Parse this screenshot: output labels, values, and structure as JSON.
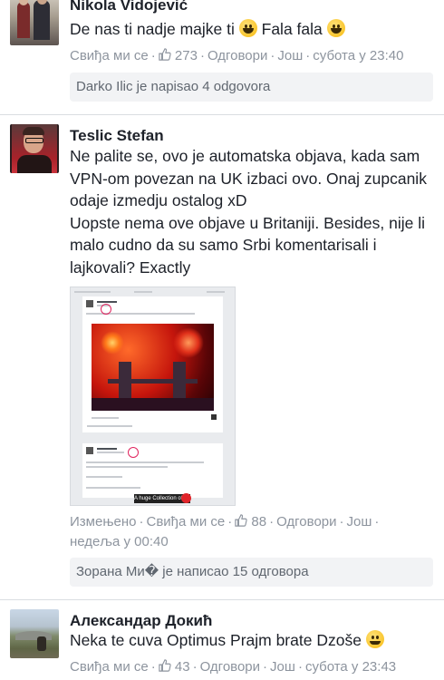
{
  "comments": [
    {
      "author": "Nikola Vidojević",
      "text_before_emoji1": "De nas ti nadje majke ti ",
      "text_between": " Fala fala ",
      "actions": {
        "like": "Свиђа ми се",
        "reaction_count": "273",
        "reply": "Одговори",
        "more": "Још",
        "time": "субота у 23:40"
      },
      "replies": "Darko Ilic je napisao 4 odgovora"
    },
    {
      "author": "Teslic Stefan",
      "paragraph1": "Ne palite se, ovo je automatska objava, kada sam VPN-om povezan na UK izbaci ovo. Onaj zupcanik odaje izmedju ostalog xD",
      "paragraph2": "Uopste nema ove objave u Britaniji. Besides, nije li malo cudno da su samo Srbi komentarisali i lajkovali? Exactly",
      "attachment": {
        "banner": "A huge Collection of Services"
      },
      "actions": {
        "edited": "Измењено",
        "like": "Свиђа ми се",
        "reaction_count": "88",
        "reply": "Одговори",
        "more": "Још",
        "time": "недеља у 00:40"
      },
      "replies": "Зорана Ми� је написао 15 одговора"
    },
    {
      "author": "Александар Докић",
      "text": "Neka te cuva Optimus Prajm brate Dzoše ",
      "actions": {
        "like": "Свиђа ми се",
        "reaction_count": "43",
        "reply": "Одговори",
        "more": "Још",
        "time": "субота у 23:43"
      }
    }
  ],
  "colors": {
    "link": "#8d949e",
    "text": "#1d2129",
    "reply_bg": "#f2f3f5",
    "like_blue": "#4267b2"
  },
  "icons": [
    "thumbs-up-icon",
    "smiley-emoji-icon"
  ]
}
